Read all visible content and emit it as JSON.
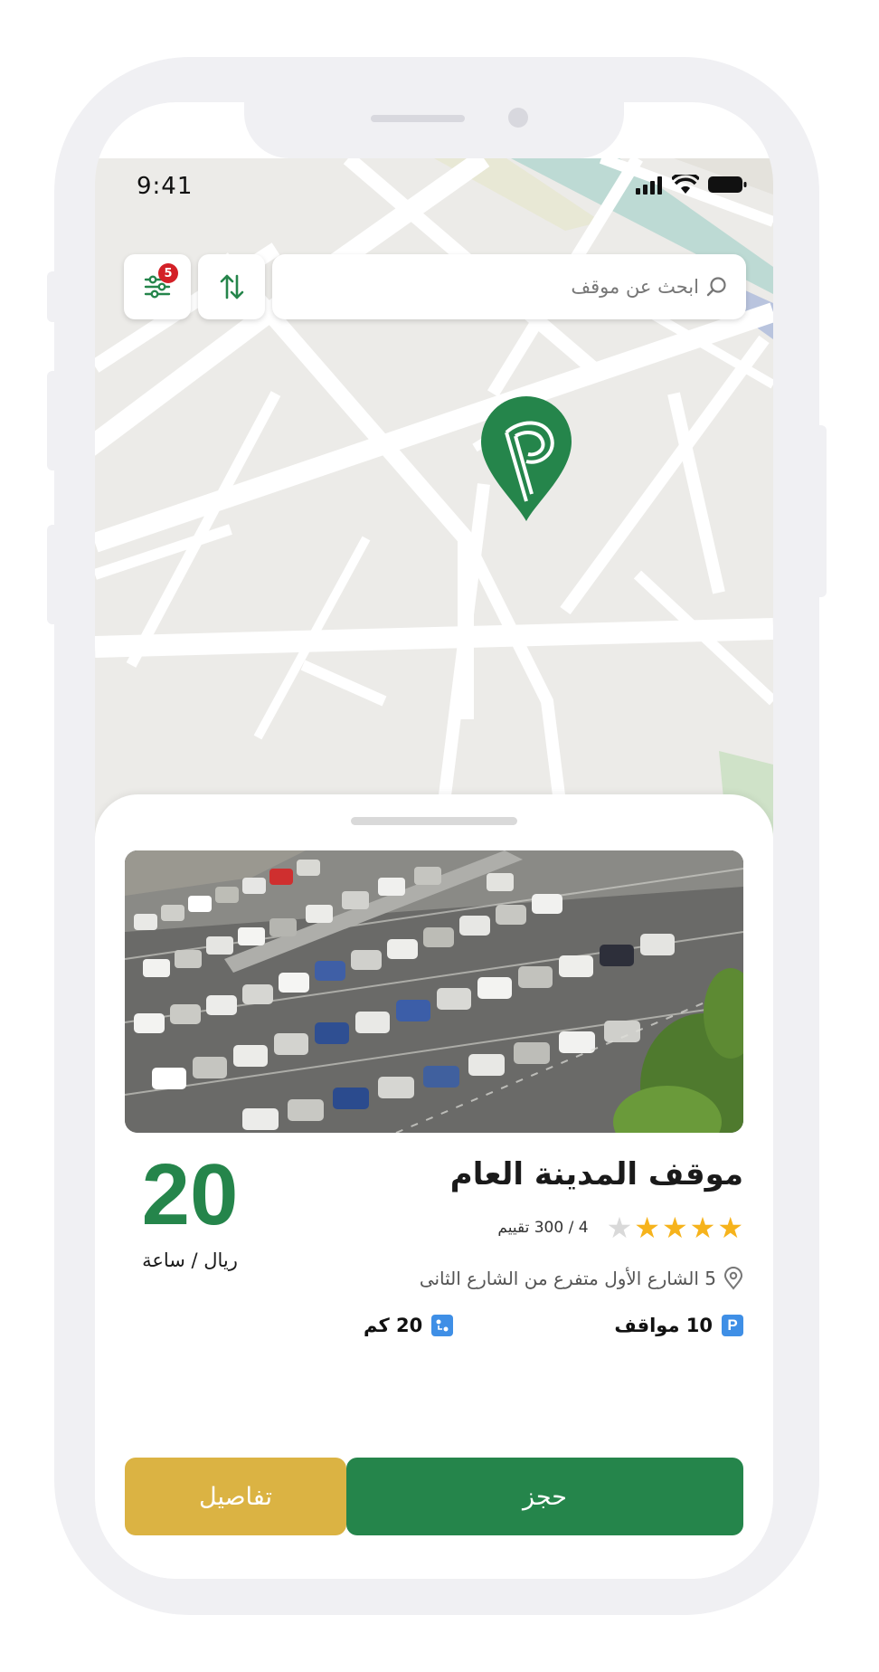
{
  "status_bar": {
    "time": "9:41"
  },
  "search": {
    "placeholder": "ابحث عن موقف",
    "filter_badge": "5"
  },
  "parking": {
    "name": "موقف المدينة العام",
    "rating_value": 4,
    "rating_max": 5,
    "rating_text": "4 / 300 تقييم",
    "address": "5  الشارع الأول متفرع من الشارع الثانى",
    "spots_text": "10 مواقف",
    "distance_text": "20 كم",
    "price": "20",
    "price_unit": "ريال / ساعة"
  },
  "actions": {
    "book_label": "حجز",
    "details_label": "تفاصيل"
  },
  "icons": {
    "filter": "sliders-icon",
    "sort": "sort-arrows-icon",
    "search": "search-icon",
    "pin": "parking-pin-icon",
    "location": "location-pin-icon",
    "parking": "parking-icon",
    "distance": "distance-icon"
  },
  "colors": {
    "primary_green": "#25854b",
    "accent_gold": "#dbb343",
    "star_gold": "#f6b31c",
    "badge_red": "#d32027",
    "info_blue": "#3f8fe6"
  }
}
